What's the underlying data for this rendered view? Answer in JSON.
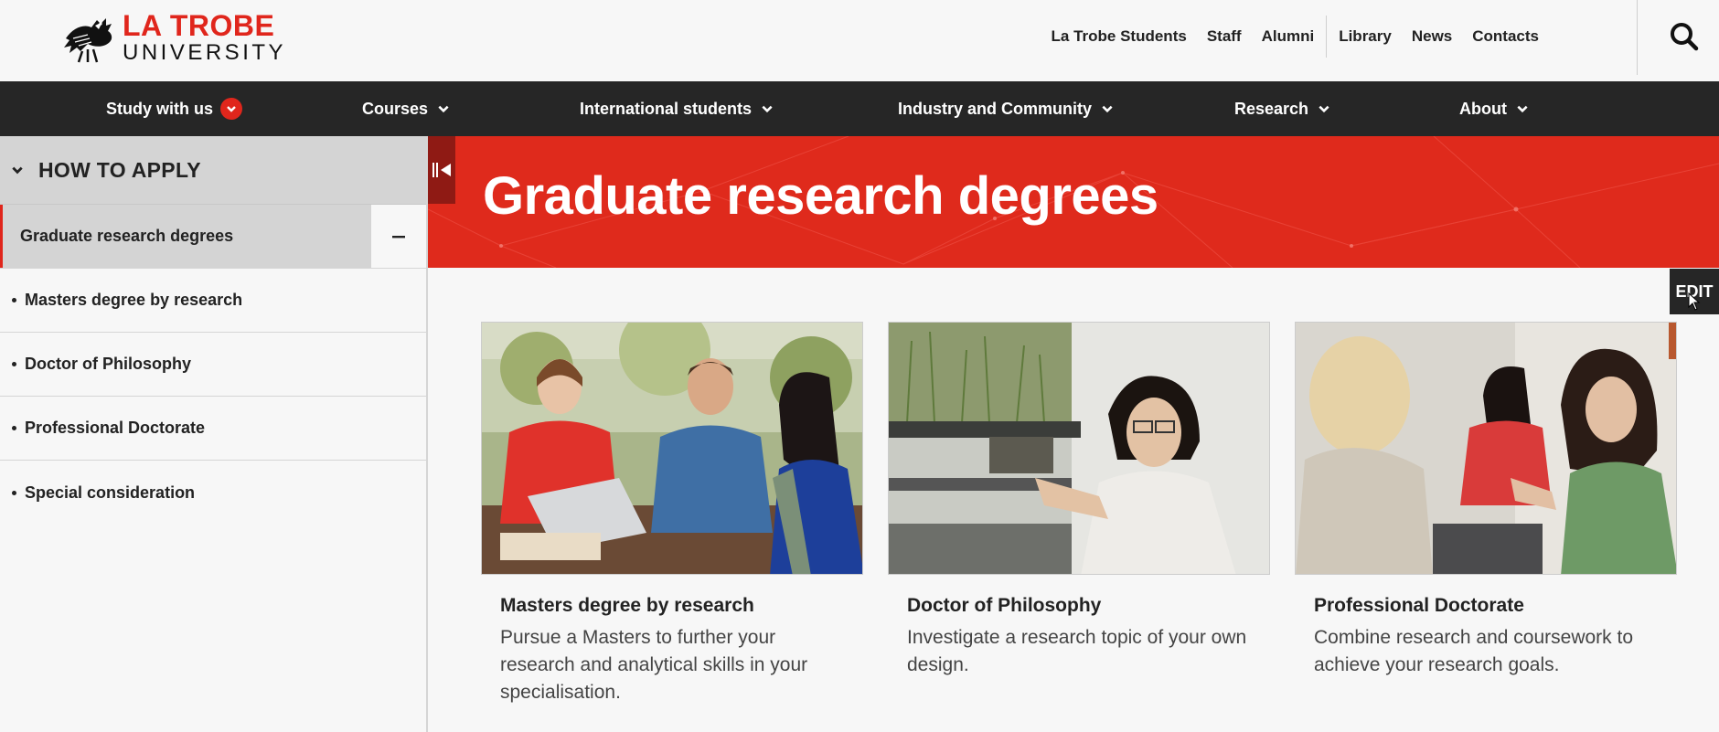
{
  "brand": {
    "line1": "LA TROBE",
    "line2": "UNIVERSITY",
    "color": "#e0261c"
  },
  "utility_nav": [
    "La Trobe Students",
    "Staff",
    "Alumni",
    "Library",
    "News",
    "Contacts"
  ],
  "search": {
    "icon": "search-icon"
  },
  "main_nav": [
    {
      "label": "Study with us",
      "icon": "chevron-down-icon"
    },
    {
      "label": "Courses",
      "icon": "chevron-down-icon"
    },
    {
      "label": "International students",
      "icon": "chevron-down-icon"
    },
    {
      "label": "Industry and Community",
      "icon": "chevron-down-icon"
    },
    {
      "label": "Research",
      "icon": "chevron-down-icon"
    },
    {
      "label": "About",
      "icon": "chevron-down-icon"
    }
  ],
  "sidebar": {
    "heading": "HOW TO APPLY",
    "current": "Graduate research degrees",
    "collapse_symbol": "–",
    "items": [
      "Masters degree by research",
      "Doctor of Philosophy",
      "Professional Doctorate",
      "Special consideration"
    ]
  },
  "hero": {
    "title": "Graduate research degrees",
    "color": "#df2a1c"
  },
  "edit_label": "EDIT",
  "cards": [
    {
      "title": "Masters degree by research",
      "description": "Pursue a Masters to further your research and analytical skills in your specialisation."
    },
    {
      "title": "Doctor of Philosophy",
      "description": "Investigate a research topic of your own design."
    },
    {
      "title": "Professional Doctorate",
      "description": "Combine research and coursework to achieve your research goals."
    }
  ]
}
